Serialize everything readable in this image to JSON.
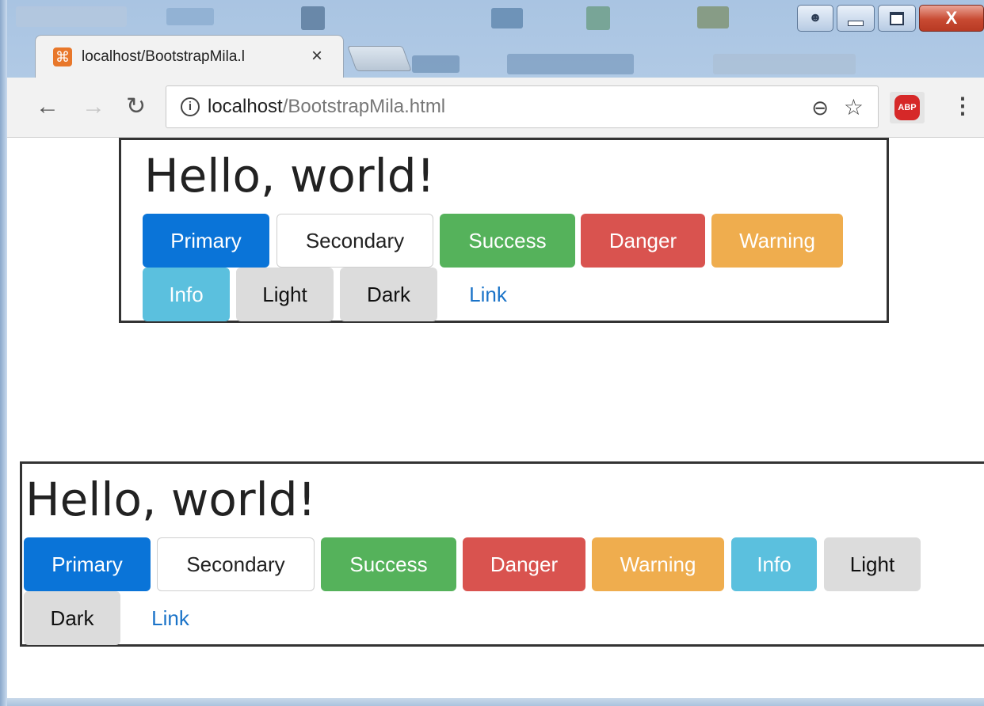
{
  "browser": {
    "tab_title": "localhost/BootstrapMila.l",
    "tab_close": "×",
    "url_host": "localhost",
    "url_path": "/BootstrapMila.html",
    "extension_label": "ABP",
    "icons": [
      "back-arrow-icon",
      "forward-arrow-icon",
      "reload-icon",
      "info-icon",
      "zoom-out-icon",
      "star-icon",
      "adblock-icon",
      "more-menu-icon"
    ]
  },
  "window_controls": {
    "close_glyph": "X"
  },
  "page": {
    "sections": [
      {
        "heading": "Hello, world!",
        "buttons": [
          {
            "label": "Primary",
            "variant": "primary"
          },
          {
            "label": "Secondary",
            "variant": "secondary"
          },
          {
            "label": "Success",
            "variant": "success"
          },
          {
            "label": "Danger",
            "variant": "danger"
          },
          {
            "label": "Warning",
            "variant": "warning"
          },
          {
            "label": "Info",
            "variant": "info"
          },
          {
            "label": "Light",
            "variant": "light"
          },
          {
            "label": "Dark",
            "variant": "dark"
          },
          {
            "label": "Link",
            "variant": "link"
          }
        ]
      },
      {
        "heading": "Hello, world!",
        "buttons": [
          {
            "label": "Primary",
            "variant": "primary"
          },
          {
            "label": "Secondary",
            "variant": "secondary"
          },
          {
            "label": "Success",
            "variant": "success"
          },
          {
            "label": "Danger",
            "variant": "danger"
          },
          {
            "label": "Warning",
            "variant": "warning"
          },
          {
            "label": "Info",
            "variant": "info"
          },
          {
            "label": "Light",
            "variant": "light"
          },
          {
            "label": "Dark",
            "variant": "dark"
          },
          {
            "label": "Link",
            "variant": "link"
          }
        ]
      }
    ]
  },
  "colors": {
    "primary": "#0a74d8",
    "success": "#55b25b",
    "danger": "#d9534f",
    "warning": "#efad4e",
    "info": "#5bc0de",
    "light": "#dcdcdc",
    "link": "#1a73c8"
  }
}
